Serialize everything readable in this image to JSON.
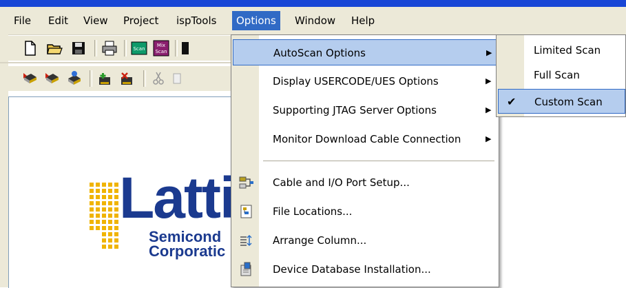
{
  "menubar": {
    "items": [
      {
        "label": "File"
      },
      {
        "label": "Edit"
      },
      {
        "label": "View"
      },
      {
        "label": "Project"
      },
      {
        "label": "ispTools"
      },
      {
        "label": "Options"
      },
      {
        "label": "Window"
      },
      {
        "label": "Help"
      }
    ]
  },
  "toolbar": {
    "scan_label": "Scan",
    "mix_label_1": "Mix",
    "mix_label_2": "Scan"
  },
  "logo": {
    "word": "Lattic",
    "line1": "Semicond",
    "line2": "Corporatic"
  },
  "options_menu": {
    "items": [
      {
        "label": "AutoScan Options",
        "has_submenu": true
      },
      {
        "label": "Display USERCODE/UES Options",
        "has_submenu": true
      },
      {
        "label": "Supporting JTAG Server Options",
        "has_submenu": true
      },
      {
        "label": "Monitor Download Cable Connection",
        "has_submenu": true
      },
      {
        "label": "Cable and I/O Port Setup..."
      },
      {
        "label": "File Locations..."
      },
      {
        "label": "Arrange Column..."
      },
      {
        "label": "Device Database Installation..."
      }
    ]
  },
  "autoscan_submenu": {
    "items": [
      {
        "label": "Limited Scan"
      },
      {
        "label": "Full Scan"
      },
      {
        "label": "Custom Scan",
        "checked": true
      }
    ]
  },
  "colors": {
    "highlight": "#316ac5",
    "menu_hover": "#b5cdee",
    "logo_blue": "#1b3a8f",
    "logo_gold": "#f0b400"
  }
}
